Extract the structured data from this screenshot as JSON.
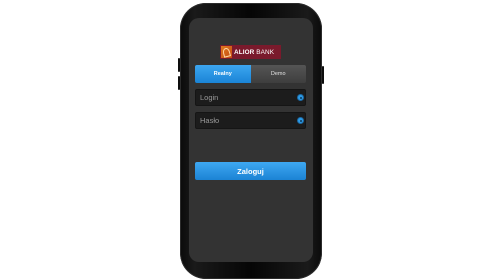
{
  "brand": {
    "name_bold": "ALIOR",
    "name_light": "BANK",
    "color": "#7a1a2c",
    "accent": "#e07a1f"
  },
  "mode_tabs": [
    {
      "label": "Realny",
      "active": true
    },
    {
      "label": "Demo",
      "active": false
    }
  ],
  "form": {
    "login_placeholder": "Login",
    "password_placeholder": "Hasło",
    "login_value": "",
    "password_value": "",
    "field_icon": "info-dot-icon",
    "submit_label": "Zaloguj"
  },
  "colors": {
    "screen_bg": "#333333",
    "primary_blue": "#1a84d6",
    "field_bg": "#1c1c1c"
  }
}
